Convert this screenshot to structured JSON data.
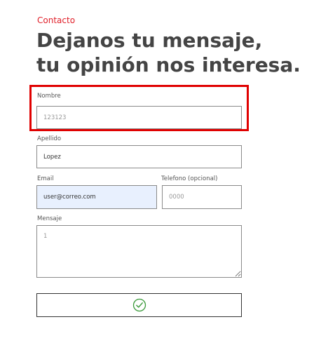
{
  "header": {
    "eyebrow": "Contacto",
    "headline_line1": "Dejanos tu mensaje,",
    "headline_line2": "tu opinión nos interesa."
  },
  "form": {
    "nombre": {
      "label": "Nombre",
      "value": "123123"
    },
    "apellido": {
      "label": "Apellido",
      "value": "Lopez"
    },
    "email": {
      "label": "Email",
      "value": "user@correo.com"
    },
    "telefono": {
      "label": "Telefono (opcional)",
      "value": "0000"
    },
    "mensaje": {
      "label": "Mensaje",
      "value": "1"
    },
    "submit": {
      "icon": "check-circle-icon"
    }
  },
  "colors": {
    "accent": "#e0202a",
    "highlight_box": "#e00000",
    "autofill_bg": "#e8f0fe",
    "heading": "#444444"
  }
}
